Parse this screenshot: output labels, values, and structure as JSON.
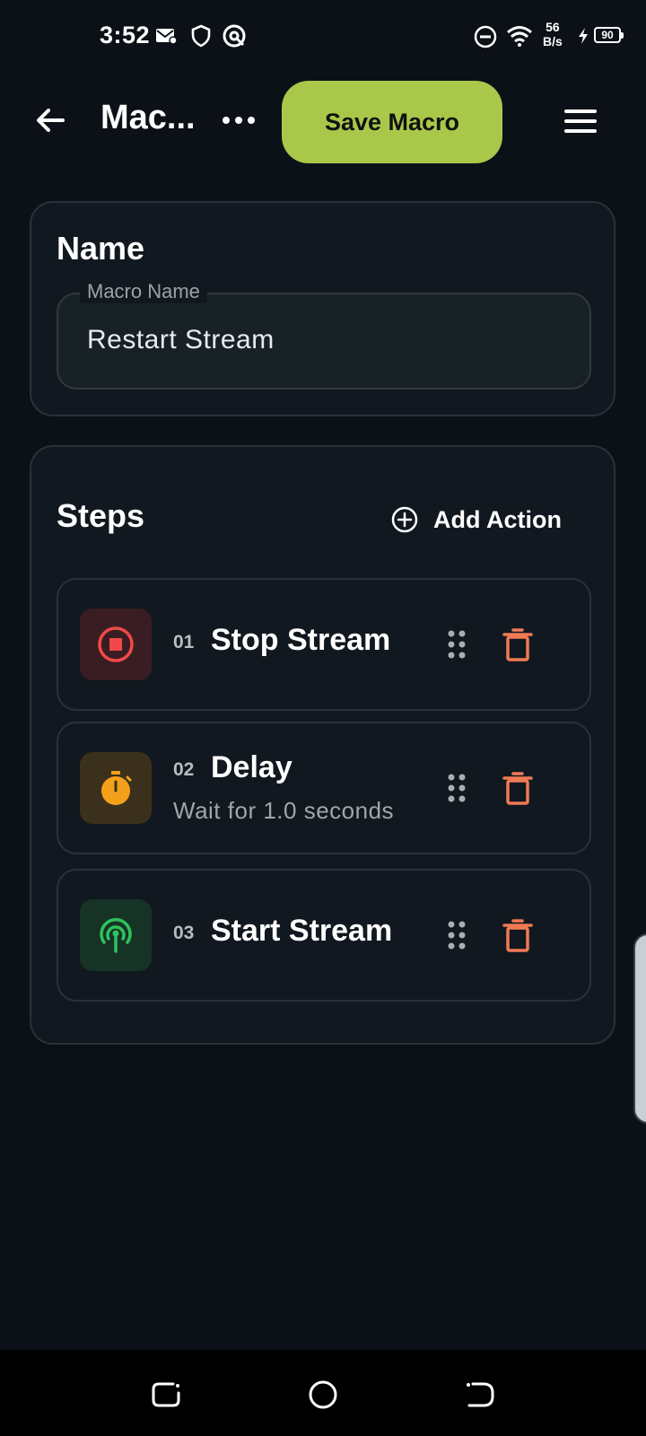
{
  "status_bar": {
    "time": "3:52",
    "net_speed_value": "56",
    "net_speed_unit": "B/s",
    "battery": "90",
    "icons": [
      "mail-icon",
      "shield-icon",
      "vpn-icon",
      "dnd-icon",
      "wifi-icon",
      "charging-icon",
      "battery-icon"
    ]
  },
  "app_bar": {
    "title": "Mac...",
    "save_label": "Save Macro",
    "save_color": "#a9c84a"
  },
  "name_card": {
    "title": "Name",
    "field_label": "Macro Name",
    "field_value": "Restart Stream"
  },
  "steps_card": {
    "title": "Steps",
    "add_action_label": "Add Action",
    "steps": [
      {
        "num": "01",
        "title": "Stop Stream",
        "subtitle": "",
        "icon": "stop-icon",
        "icon_color": "#ef4a48",
        "icon_bg": "#3a1d22"
      },
      {
        "num": "02",
        "title": "Delay",
        "subtitle": "Wait for 1.0 seconds",
        "icon": "timer-icon",
        "icon_color": "#f3a11a",
        "icon_bg": "#3b301b"
      },
      {
        "num": "03",
        "title": "Start Stream",
        "subtitle": "",
        "icon": "broadcast-icon",
        "icon_color": "#2fc25e",
        "icon_bg": "#173326"
      }
    ],
    "delete_color": "#f07a55"
  },
  "nav_bar": {
    "buttons": [
      "recents-icon",
      "home-icon",
      "back-icon"
    ]
  }
}
